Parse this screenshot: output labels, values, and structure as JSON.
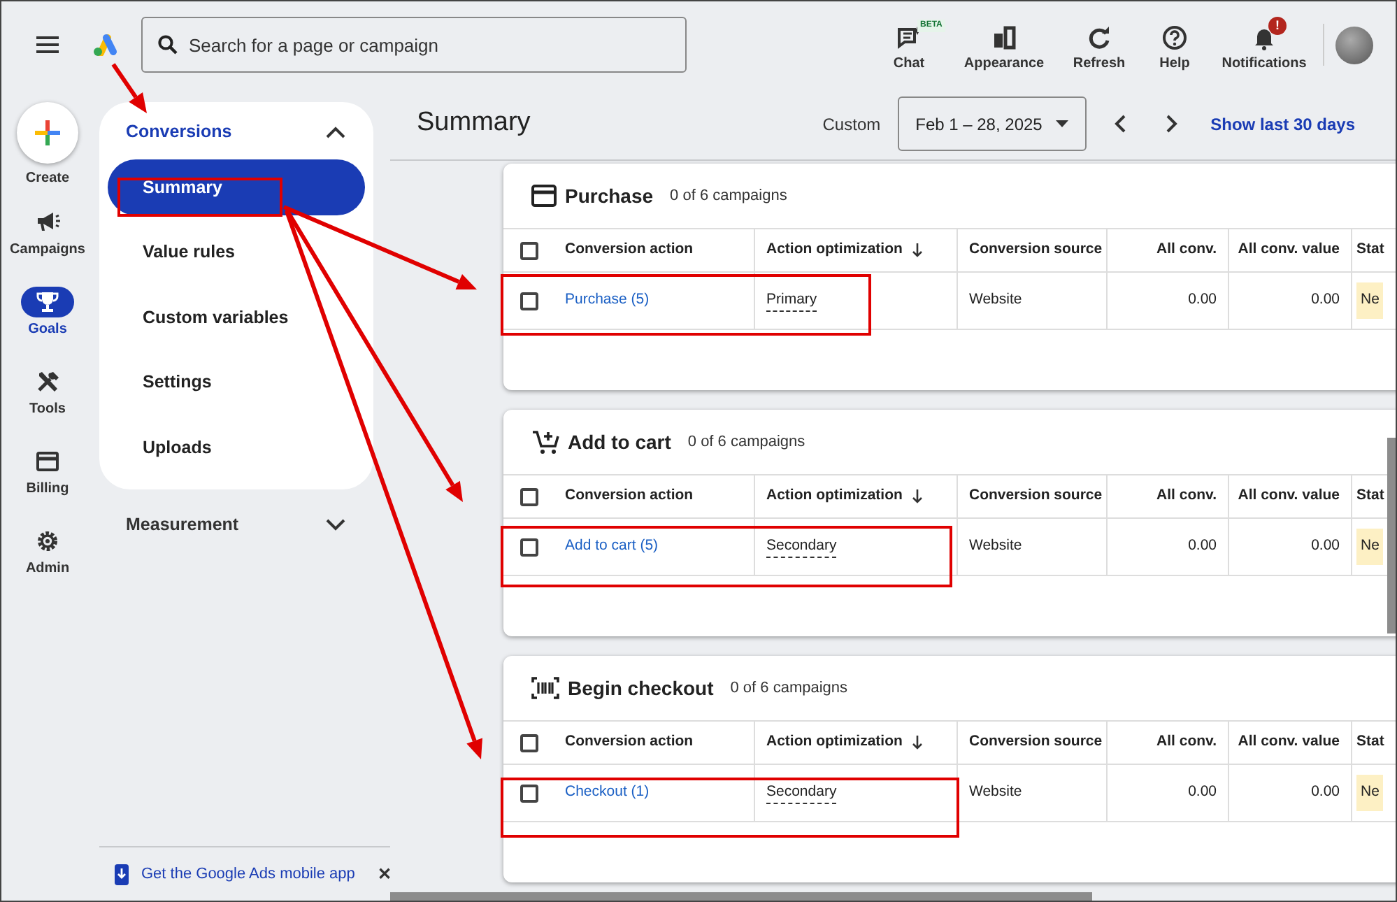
{
  "top_bar": {
    "search": {
      "placeholder": "Search for a page or campaign"
    },
    "actions": [
      {
        "label": "Chat",
        "badge": "BETA"
      },
      {
        "label": "Appearance"
      },
      {
        "label": "Refresh"
      },
      {
        "label": "Help"
      },
      {
        "label": "Notifications",
        "alert": "!"
      }
    ]
  },
  "rail": {
    "create": "Create",
    "items": [
      {
        "label": "Campaigns",
        "selected": false
      },
      {
        "label": "Goals",
        "selected": true
      },
      {
        "label": "Tools",
        "selected": false
      },
      {
        "label": "Billing",
        "selected": false
      },
      {
        "label": "Admin",
        "selected": false
      }
    ]
  },
  "nav": [
    {
      "label": "Conversions",
      "expanded": true,
      "children": [
        {
          "label": "Summary",
          "selected": true
        },
        {
          "label": "Value rules",
          "selected": false
        },
        {
          "label": "Custom variables",
          "selected": false
        },
        {
          "label": "Settings",
          "selected": false
        },
        {
          "label": "Uploads",
          "selected": false
        }
      ]
    },
    {
      "label": "Measurement",
      "expanded": false
    }
  ],
  "promo": {
    "text": "Get the Google Ads mobile app",
    "close": "✕"
  },
  "page": {
    "title": "Summary",
    "date_label": "Custom",
    "date_range": "Feb 1 – 28, 2025",
    "show_last": "Show last 30 days"
  },
  "cards": [
    {
      "title": "Purchase",
      "count": "0 of 6 campaigns",
      "all_checked": false,
      "columns": [
        {
          "label": "Conversion action",
          "sorted": false
        },
        {
          "label": "Action optimization",
          "sorted": true
        },
        {
          "label": "Conversion source",
          "sorted": false
        },
        {
          "label": "All conv.",
          "sorted": false
        },
        {
          "label": "All conv. value",
          "sorted": false
        },
        {
          "label": "Stat",
          "sorted": false
        }
      ],
      "rows": [
        {
          "checked": false,
          "action": "Purchase (5)",
          "optimization": "Primary",
          "source": "Website",
          "all_conv": "0.00",
          "all_conv_value": "0.00",
          "status": "Ne"
        }
      ]
    },
    {
      "title": "Add to cart",
      "count": "0 of 6 campaigns",
      "all_checked": false,
      "columns": [
        {
          "label": "Conversion action",
          "sorted": false
        },
        {
          "label": "Action optimization",
          "sorted": true
        },
        {
          "label": "Conversion source",
          "sorted": false
        },
        {
          "label": "All conv.",
          "sorted": false
        },
        {
          "label": "All conv. value",
          "sorted": false
        },
        {
          "label": "Stat",
          "sorted": false
        }
      ],
      "rows": [
        {
          "checked": false,
          "action": "Add to cart (5)",
          "optimization": "Secondary",
          "source": "Website",
          "all_conv": "0.00",
          "all_conv_value": "0.00",
          "status": "Ne"
        }
      ]
    },
    {
      "title": "Begin checkout",
      "count": "0 of 6 campaigns",
      "all_checked": false,
      "columns": [
        {
          "label": "Conversion action",
          "sorted": false
        },
        {
          "label": "Action optimization",
          "sorted": true
        },
        {
          "label": "Conversion source",
          "sorted": false
        },
        {
          "label": "All conv.",
          "sorted": false
        },
        {
          "label": "All conv. value",
          "sorted": false
        },
        {
          "label": "Stat",
          "sorted": false
        }
      ],
      "rows": [
        {
          "checked": false,
          "action": "Checkout (1)",
          "optimization": "Secondary",
          "source": "Website",
          "all_conv": "0.00",
          "all_conv_value": "0.00",
          "status": "Ne"
        }
      ]
    }
  ]
}
